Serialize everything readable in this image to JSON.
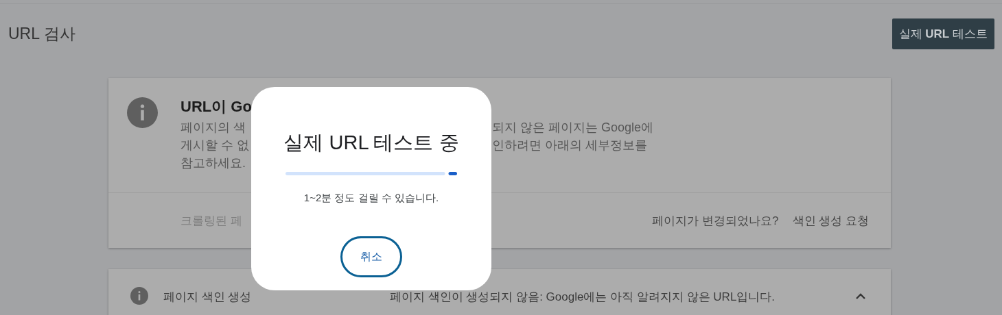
{
  "header": {
    "title": "URL 검사",
    "test_button": "실제 **URL** 테스트"
  },
  "status_card": {
    "title": "URL이 Go",
    "description_left": [
      "페이지의 색",
      "게시할 수 없",
      "참고하세요."
    ],
    "description_right": [
      "되지 않은 페이지는 Google에",
      "인하려면 아래의 세부정보를"
    ],
    "footer_left": "크롤링된 페",
    "footer_question": "페이지가 변경되었나요?",
    "footer_action": "색인 생성 요청"
  },
  "indexing_row": {
    "label": "페이지 색인 생성",
    "value": "페이지 색인이 생성되지 않음: Google에는 아직 알려지지 않은 URL입니다.",
    "expanded": true
  },
  "dialog": {
    "title": "실제 URL 테스트 중",
    "progress": {
      "level": 0.05
    },
    "message": "1~2분 정도 걸릴 수 있습니다.",
    "cancel_button": "취소"
  }
}
